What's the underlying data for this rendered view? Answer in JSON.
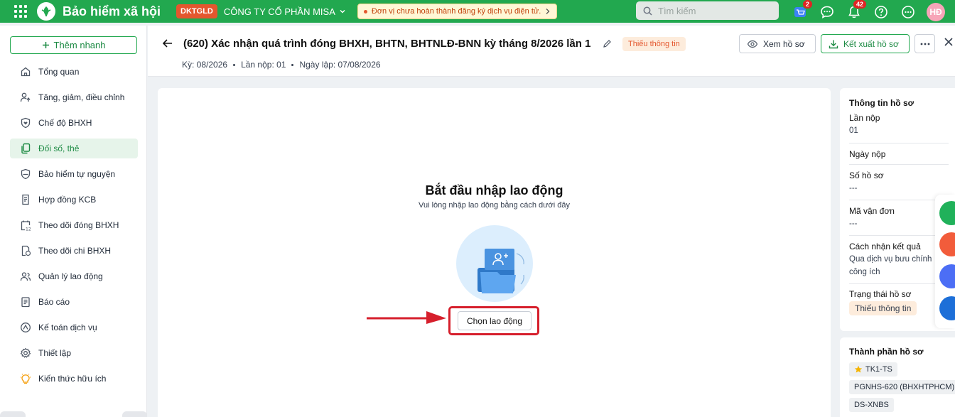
{
  "app": {
    "name": "Bảo hiểm xã hội",
    "org_badge": "DKTGLD",
    "org_name": "CÔNG TY CỔ PHẦN MISA",
    "warning": "Đơn vị chưa hoàn thành đăng ký dịch vụ điện tử.",
    "search_placeholder": "Tìm kiếm",
    "cart_badge": "2",
    "notif_badge": "42",
    "avatar": "HĐ",
    "brand_color": "#22a84f"
  },
  "sidebar": {
    "quick_add": "Thêm nhanh",
    "items": [
      {
        "label": "Tổng quan",
        "icon": "home-icon"
      },
      {
        "label": "Tăng, giảm, điều chỉnh",
        "icon": "user-adjust-icon"
      },
      {
        "label": "Chế độ BHXH",
        "icon": "shield-heart-icon"
      },
      {
        "label": "Đối số, thẻ",
        "icon": "cards-icon",
        "active": true
      },
      {
        "label": "Bảo hiểm tự nguyện",
        "icon": "shield-icon"
      },
      {
        "label": "Hợp đồng KCB",
        "icon": "contract-icon"
      },
      {
        "label": "Theo dõi đóng BHXH",
        "icon": "calendar-icon"
      },
      {
        "label": "Theo dõi chi BHXH",
        "icon": "document-money-icon"
      },
      {
        "label": "Quản lý lao động",
        "icon": "users-icon"
      },
      {
        "label": "Báo cáo",
        "icon": "report-icon"
      },
      {
        "label": "Kế toán dịch vụ",
        "icon": "accounting-icon"
      },
      {
        "label": "Thiết lập",
        "icon": "gear-icon"
      },
      {
        "label": "Kiến thức hữu ích",
        "icon": "lightbulb-icon"
      }
    ]
  },
  "header": {
    "title": "(620) Xác nhận quá trình đóng BHXH, BHTN, BHTNLĐ-BNN kỳ tháng 8/2026 lần 1",
    "status": "Thiếu thông tin",
    "period": "Kỳ: 08/2026",
    "submission": "Lần nộp: 01",
    "created": "Ngày lập: 07/08/2026",
    "view_button": "Xem hồ sơ",
    "export_button": "Kết xuất hồ sơ"
  },
  "main": {
    "empty_title": "Bắt đầu nhập lao động",
    "empty_subtitle": "Vui lòng nhập lao động bằng cách dưới đây",
    "pick_button": "Chọn lao động"
  },
  "info_panel": {
    "title": "Thông tin hồ sơ",
    "fields": [
      {
        "label": "Lần nộp",
        "value": "01"
      },
      {
        "label": "Ngày nộp",
        "value": ""
      },
      {
        "label": "Số hồ sơ",
        "value": "---"
      },
      {
        "label": "Mã vận đơn",
        "value": "---"
      },
      {
        "label": "Cách nhận kết quả",
        "value": "Qua dịch vụ bưu chính công ích"
      },
      {
        "label": "Trạng thái hồ sơ",
        "value": "Thiếu thông tin"
      }
    ]
  },
  "components_panel": {
    "title": "Thành phần hồ sơ",
    "chips": [
      "TK1-TS",
      "PGNHS-620 (BHXHTPHCM)",
      "DS-XNBS"
    ]
  }
}
